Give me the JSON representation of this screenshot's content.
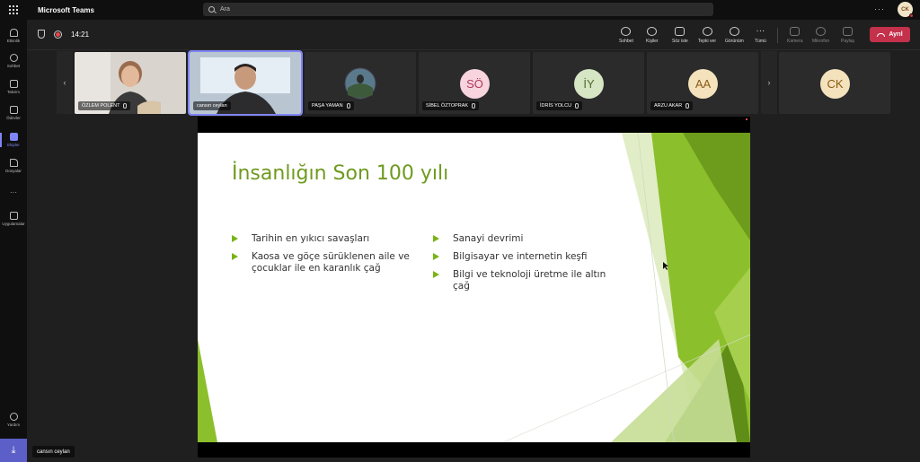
{
  "titlebar": {
    "app_name": "Microsoft Teams",
    "search_placeholder": "Ara",
    "more": "···",
    "me_initials": "CK"
  },
  "rail": {
    "items": [
      {
        "label": "Etkinlik",
        "icon": "bell-icon"
      },
      {
        "label": "Sohbet",
        "icon": "chat-icon"
      },
      {
        "label": "Takvim",
        "icon": "calendar-icon"
      },
      {
        "label": "Ödevler",
        "icon": "assignments-icon"
      },
      {
        "label": "Ekipler",
        "icon": "teams-icon",
        "active": true
      },
      {
        "label": "Dosyalar",
        "icon": "files-icon"
      }
    ],
    "more": "···",
    "apps_label": "Uygulamalar",
    "help_label": "Yardım"
  },
  "meeting": {
    "timer": "14:21",
    "toolbar": {
      "chat": "Sohbet",
      "people": "Kişiler",
      "raise_hand": "Söz iste",
      "react": "Tepki ver",
      "view": "Görünüm",
      "more": "Tümü",
      "camera": "Kamera",
      "mic": "Mikrofon",
      "share": "Paylaş",
      "leave": "Ayrıl"
    }
  },
  "participants": [
    {
      "name": "ÖZLEM POLENT"
    },
    {
      "name": "cansın ceylan"
    },
    {
      "name": "PAŞA YAMAN"
    },
    {
      "name": "SİBEL ÖZTOPRAK",
      "initials": "SÖ",
      "color": "#f7d4de",
      "text_color": "#b13a5e"
    },
    {
      "name": "İDRİS YOLCU",
      "initials": "İY",
      "color": "#d6e5c4",
      "text_color": "#4f6b2a"
    },
    {
      "name": "ARZU AKAR",
      "initials": "AA",
      "color": "#f4e2bd",
      "text_color": "#8a5a16"
    },
    {
      "initials": "CK",
      "color": "#f4e2bd",
      "text_color": "#8a5a16"
    }
  ],
  "slide": {
    "title": "İnsanlığın Son 100 yılı",
    "left_bullets": [
      "Tarihin en yıkıcı savaşları",
      "Kaosa ve göçe sürüklenen aile ve çocuklar ile en karanlık çağ"
    ],
    "right_bullets": [
      "Sanayi devrimi",
      "Bilgisayar ve internetin keşfi",
      "Bilgi ve teknoloji üretme ile altın çağ"
    ]
  },
  "presenter_label": "cansın ceylan",
  "colors": {
    "accent": "#7f85f5",
    "leave": "#c4314b",
    "slide_green": "#7ab317"
  }
}
